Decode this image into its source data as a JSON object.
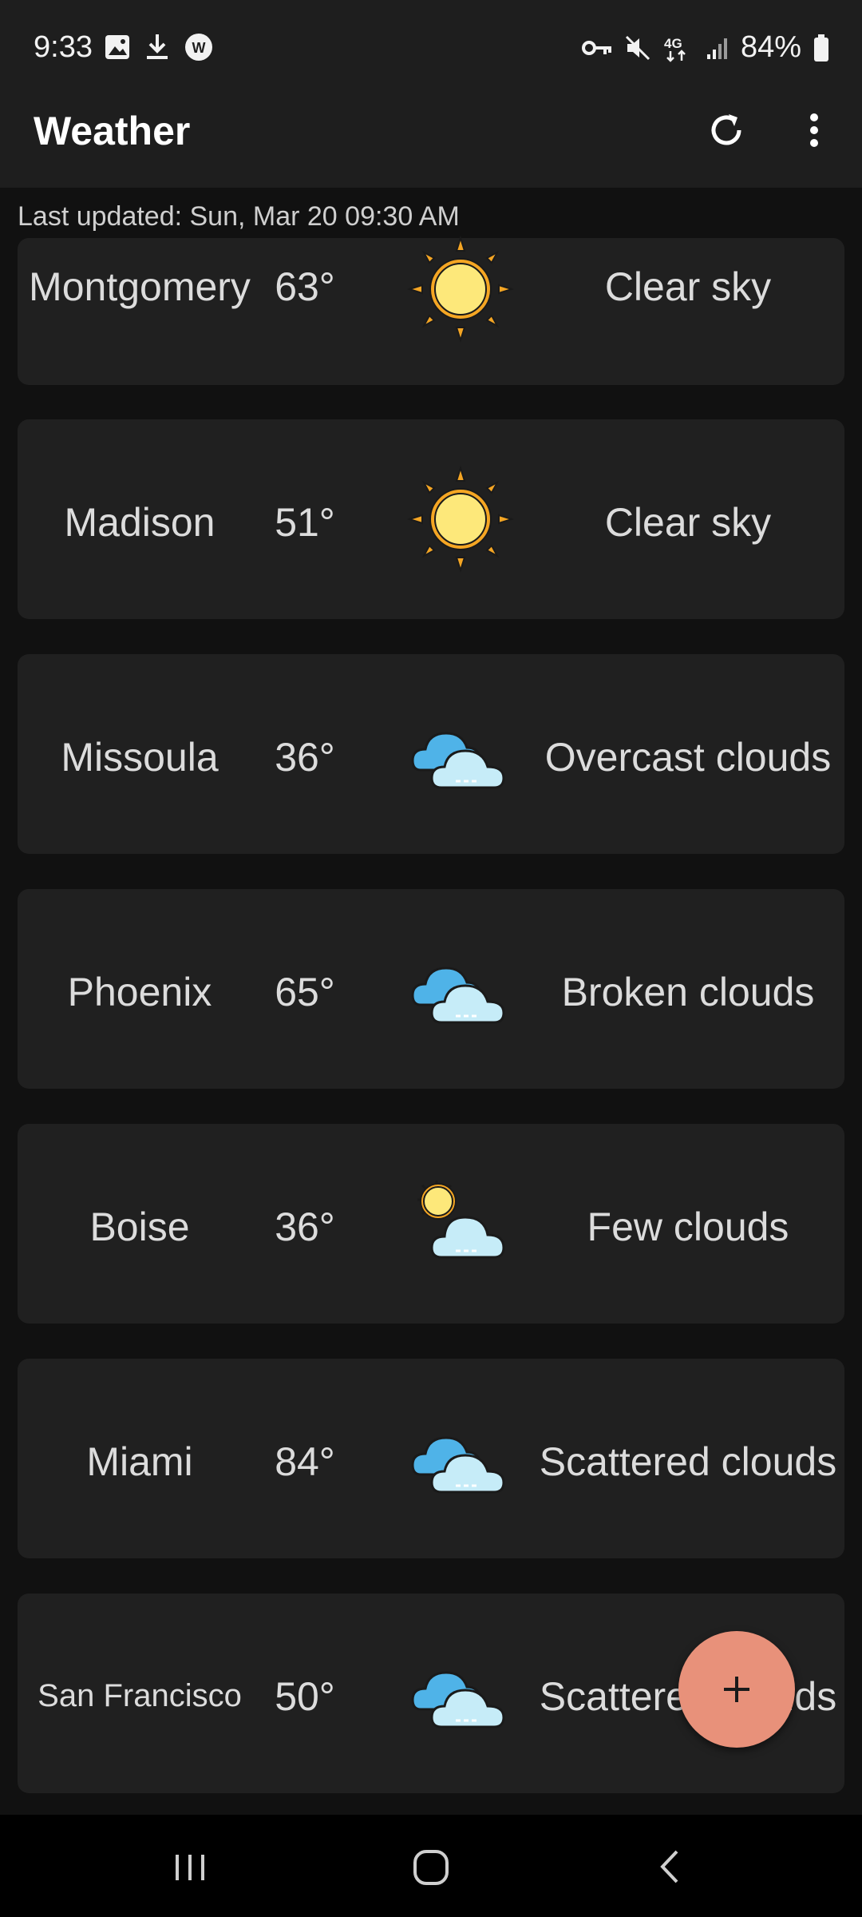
{
  "status_bar": {
    "time": "9:33",
    "battery": "84%",
    "network": "4G"
  },
  "app_bar": {
    "title": "Weather"
  },
  "last_updated": "Last updated: Sun, Mar 20 09:30 AM",
  "cities": [
    {
      "name": "Montgomery",
      "temp": "63°",
      "icon": "clear-sky-icon",
      "desc": "Clear sky"
    },
    {
      "name": "Madison",
      "temp": "51°",
      "icon": "clear-sky-icon",
      "desc": "Clear sky"
    },
    {
      "name": "Missoula",
      "temp": "36°",
      "icon": "overcast-clouds-icon",
      "desc": "Overcast clouds"
    },
    {
      "name": "Phoenix",
      "temp": "65°",
      "icon": "broken-clouds-icon",
      "desc": "Broken clouds"
    },
    {
      "name": "Boise",
      "temp": "36°",
      "icon": "few-clouds-icon",
      "desc": "Few clouds"
    },
    {
      "name": "Miami",
      "temp": "84°",
      "icon": "scattered-clouds-icon",
      "desc": "Scattered clouds"
    },
    {
      "name": "San Francisco",
      "temp": "50°",
      "icon": "scattered-clouds-icon",
      "desc": "Scattered clouds"
    }
  ],
  "fab": {
    "icon": "plus-icon"
  },
  "colors": {
    "background": "#111111",
    "card": "#202020",
    "bar": "#1e1e1e",
    "fab": "#e8917a"
  }
}
